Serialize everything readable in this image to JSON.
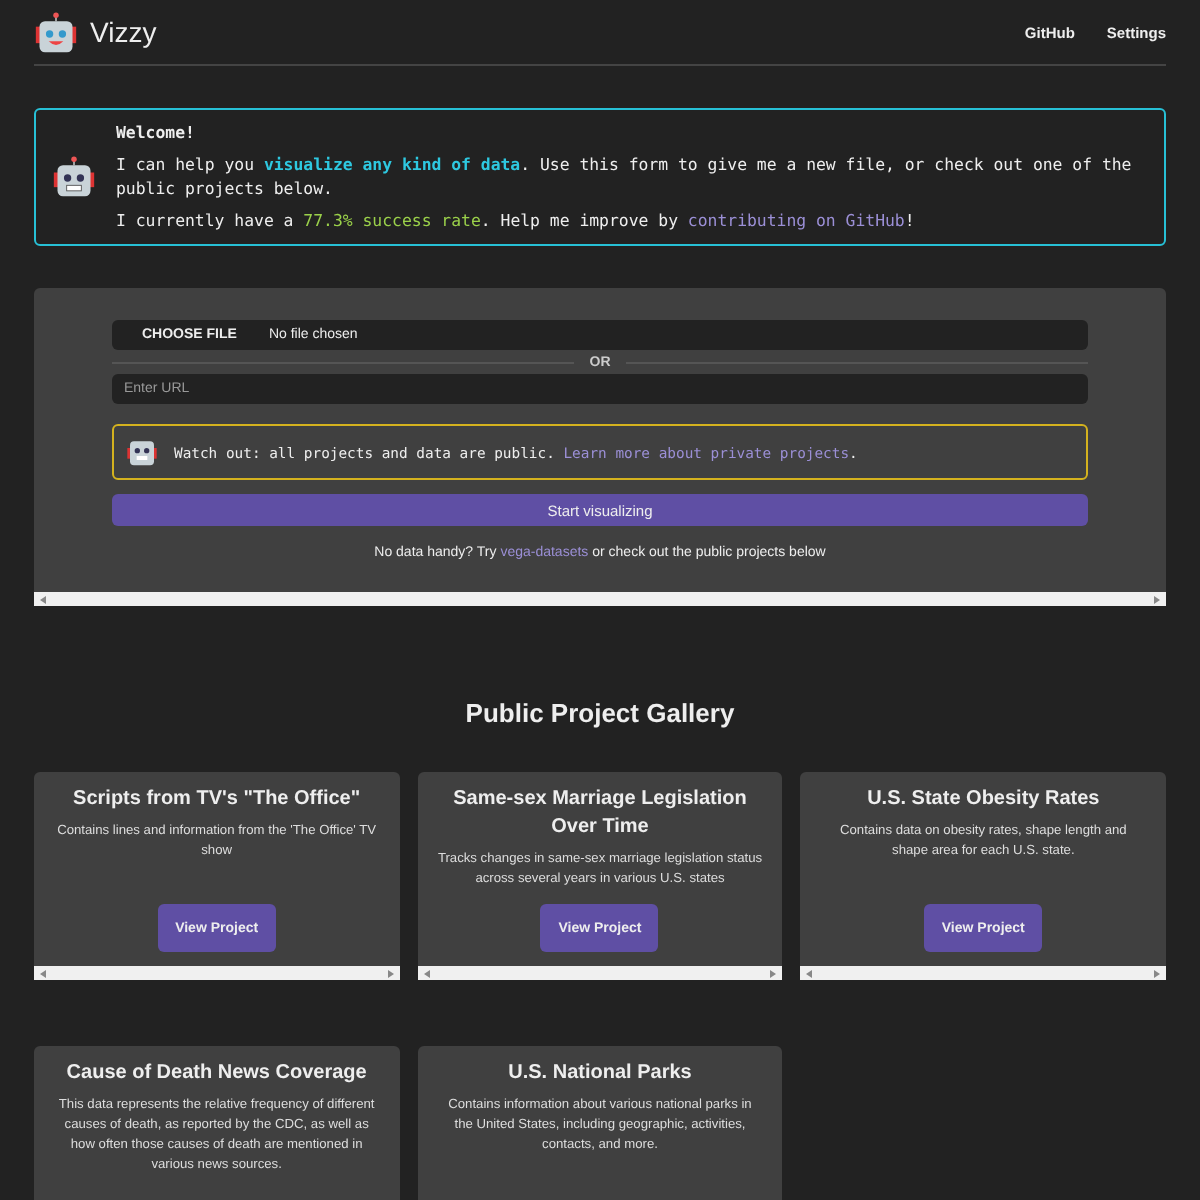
{
  "header": {
    "brand": "Vizzy",
    "nav": [
      "GitHub",
      "Settings"
    ]
  },
  "welcome": {
    "title": "Welcome!",
    "paragraphs": [
      [
        {
          "kind": "plain",
          "text": "I can help you "
        },
        {
          "kind": "highlight",
          "text": "visualize any kind of data"
        },
        {
          "kind": "plain",
          "text": ". Use this form to give me a new file, or check out one of the public projects below."
        }
      ],
      [
        {
          "kind": "plain",
          "text": "I currently have a "
        },
        {
          "kind": "stat",
          "text": "77.3% success rate"
        },
        {
          "kind": "plain",
          "text": ". Help me improve by "
        },
        {
          "kind": "link",
          "text": "contributing on GitHub"
        },
        {
          "kind": "plain",
          "text": "!"
        }
      ]
    ]
  },
  "form": {
    "file_button": "CHOOSE FILE",
    "file_status": "No file chosen",
    "divider": "OR",
    "url": {
      "placeholder": "Enter URL"
    },
    "warning": [
      {
        "kind": "plain",
        "text": "Watch out: all projects and data are public. "
      },
      {
        "kind": "link",
        "text": "Learn more about private projects"
      },
      {
        "kind": "plain",
        "text": "."
      }
    ],
    "submit": "Start visualizing",
    "hint": [
      {
        "kind": "plain",
        "text": "No data handy? Try "
      },
      {
        "kind": "link",
        "text": "vega-datasets"
      },
      {
        "kind": "plain",
        "text": " or check out the public projects below"
      }
    ]
  },
  "gallery": {
    "title": "Public Project Gallery",
    "projects": [
      {
        "title": "Scripts from TV's \"The Office\"",
        "description": "Contains lines and information from the 'The Office' TV show",
        "button": "View Project"
      },
      {
        "title": "Same-sex Marriage Legislation Over Time",
        "description": "Tracks changes in same-sex marriage legislation status across several years in various U.S. states",
        "button": "View Project"
      },
      {
        "title": "U.S. State Obesity Rates",
        "description": "Contains data on obesity rates, shape length and shape area for each U.S. state.",
        "button": "View Project"
      },
      {
        "title": "Cause of Death News Coverage",
        "description": "This data represents the relative frequency of different causes of death, as reported by the CDC, as well as how often those causes of death are mentioned in various news sources."
      },
      {
        "title": "U.S. National Parks",
        "description": "Contains information about various national parks in the United States, including geographic, activities, contacts, and more."
      }
    ]
  }
}
